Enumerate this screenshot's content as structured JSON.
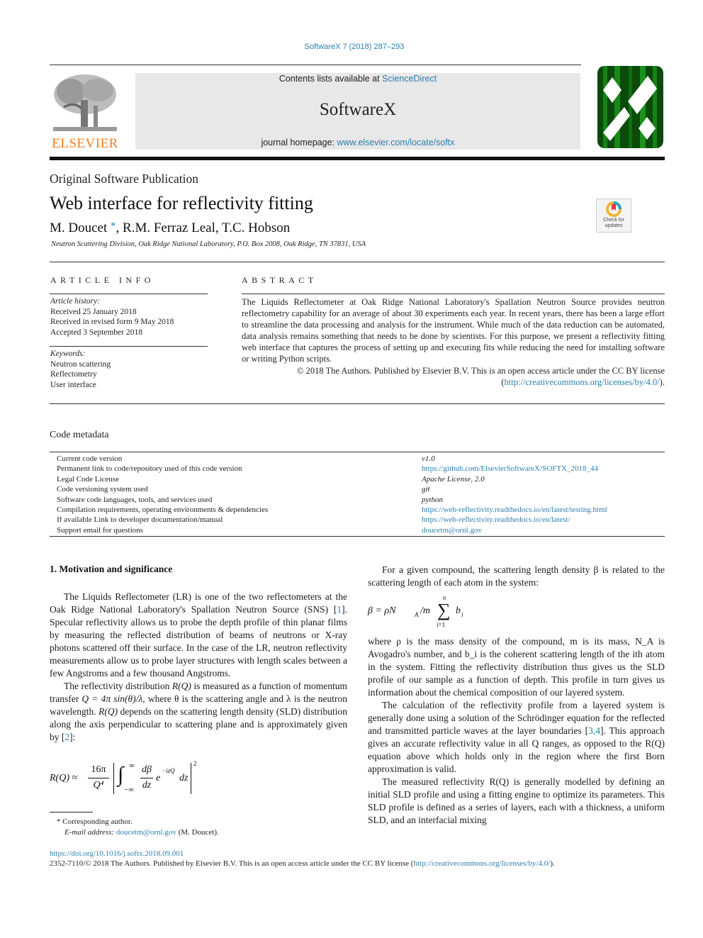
{
  "header": {
    "citation": "SoftwareX 7 (2018) 287–293",
    "contents_prefix": "Contents lists available at ",
    "contents_link": "ScienceDirect",
    "journal_name": "SoftwareX",
    "homepage_prefix": "journal homepage: ",
    "homepage_link": "www.elsevier.com/locate/softx",
    "publisher_wordmark": "ELSEVIER",
    "crossmark_label": "Check for updates"
  },
  "article": {
    "type": "Original Software Publication",
    "title": "Web interface for reflectivity fitting",
    "authors": [
      {
        "name": "M. Doucet",
        "mark": "*"
      },
      {
        "name": "R.M. Ferraz Leal"
      },
      {
        "name": "T.C. Hobson"
      }
    ],
    "author_sep": ", ",
    "affiliation": "Neutron Scattering Division, Oak Ridge National Laboratory, P.O. Box 2008, Oak Ridge, TN 37831, USA"
  },
  "article_info": {
    "heading": "ARTICLE INFO",
    "history_label": "Article history:",
    "history": [
      "Received 25 January 2018",
      "Received in revised form 9 May 2018",
      "Accepted 3 September 2018"
    ],
    "keywords_label": "Keywords:",
    "keywords": [
      "Neutron scattering",
      "Reflectometry",
      "User interface"
    ]
  },
  "abstract": {
    "heading": "ABSTRACT",
    "text": "The Liquids Reflectometer at Oak Ridge National Laboratory's Spallation Neutron Source provides neutron reflectometry capability for an average of about 30 experiments each year. In recent years, there has been a large effort to streamline the data processing and analysis for the instrument. While much of the data reduction can be automated, data analysis remains something that needs to be done by scientists. For this purpose, we present a reflectivity fitting web interface that captures the process of setting up and executing fits while reducing the need for installing software or writing Python scripts.",
    "license_text": "© 2018 The Authors. Published by Elsevier B.V. This is an open access article under the CC BY license",
    "license_open": "(",
    "license_link": "http://creativecommons.org/licenses/by/4.0/",
    "license_close": ")."
  },
  "code_metadata": {
    "title": "Code metadata",
    "rows": [
      {
        "key": "Current code version",
        "value": "v1.0",
        "kind": "italic"
      },
      {
        "key": "Permanent link to code/repository used of this code version",
        "value": "https://github.com/ElsevierSoftwareX/SOFTX_2018_44",
        "kind": "link"
      },
      {
        "key": "Legal Code License",
        "value": "Apache License, 2.0",
        "kind": "italic"
      },
      {
        "key": "Code versioning system used",
        "value": "git",
        "kind": "italic"
      },
      {
        "key": "Software code languages, tools, and services used",
        "value": "python",
        "kind": "italic"
      },
      {
        "key": "Compilation requirements, operating environments & dependencies",
        "value": "https://web-reflectivity.readthedocs.io/en/latest/testing.html",
        "kind": "link"
      },
      {
        "key": "If available Link to developer documentation/manual",
        "value": "https://web-reflectivity.readthedocs.io/en/latest/",
        "kind": "link"
      },
      {
        "key": "Support email for questions",
        "value": "doucetm@ornl.gov",
        "kind": "link"
      }
    ]
  },
  "section1": {
    "heading": "1.  Motivation and significance",
    "p1_a": "The Liquids Reflectometer (LR) is one of the two reflectometers at the Oak Ridge National Laboratory's Spallation Neutron Source (SNS) [",
    "p1_ref": "1",
    "p1_b": "]. Specular reflectivity allows us to probe the depth profile of thin planar films by measuring the reflected distribution of beams of neutrons or X-ray photons scattered off their surface. In the case of the LR, neutron reflectivity measurements allow us to probe layer structures with length scales between a few Angstroms and a few thousand Angstroms.",
    "p2_a": "The reflectivity distribution ",
    "p2_rq": "R(Q)",
    "p2_b": " is measured as a function of momentum transfer ",
    "p2_q": "Q = 4π sin(θ)/λ",
    "p2_c": ", where θ is the scattering angle and λ is the neutron wavelength. ",
    "p2_rq2": "R(Q)",
    "p2_d": " depends on the scattering length density (SLD) distribution along the axis perpendicular to scattering plane and is approximately given by [",
    "p2_ref": "2",
    "p2_e": "]:",
    "eq1": {
      "lhs": "R(Q) ≈",
      "num": "16π",
      "den": "Q⁴",
      "int_upper": "∞",
      "int_lower": "−∞",
      "frac_num": "dβ",
      "frac_den": "dz",
      "exp_base": "e",
      "exp_power": "−izQ",
      "tail": "dz",
      "power": "2"
    },
    "r1_a": "For a given compound, the scattering length density β is related to the scattering length of each atom in the system:",
    "eq2": {
      "lhs": "β = ρN",
      "sub_a": "A",
      "mid": "/m",
      "sum_upper": "n",
      "sum_lower": "i=1",
      "term": "b",
      "term_sub": "i"
    },
    "r2": "where ρ is the mass density of the compound, m is its mass, N_A is Avogadro's number, and b_i is the coherent scattering length of the ith atom in the system. Fitting the reflectivity distribution thus gives us the SLD profile of our sample as a function of depth. This profile in turn gives us information about the chemical composition of our layered system.",
    "r3_a": "The calculation of the reflectivity profile from a layered system is generally done using a solution of the Schrödinger equation for the reflected and transmitted particle waves at the layer boundaries [",
    "r3_ref": "3,4",
    "r3_b": "]. This approach gives an accurate reflectivity value in all Q ranges, as opposed to the R(Q) equation above which holds only in the region where the first Born approximation is valid.",
    "r4": "The measured reflectivity R(Q) is generally modelled by defining an initial SLD profile and using a fitting engine to optimize its parameters. This SLD profile is defined as a series of layers, each with a thickness, a uniform SLD, and an interfacial mixing"
  },
  "footnote": {
    "mark": "*",
    "text": "Corresponding author.",
    "email_label": "E-mail address:",
    "email": "doucetm@ornl.gov",
    "email_owner": " (M. Doucet)."
  },
  "footer": {
    "doi": "https://doi.org/10.1016/j.softx.2018.09.001",
    "issn_text": "2352-7110/© 2018 The Authors. Published by Elsevier B.V. This is an open access article under the CC BY license (",
    "license_link": "http://creativecommons.org/licenses/by/4.0/",
    "close": ")."
  }
}
